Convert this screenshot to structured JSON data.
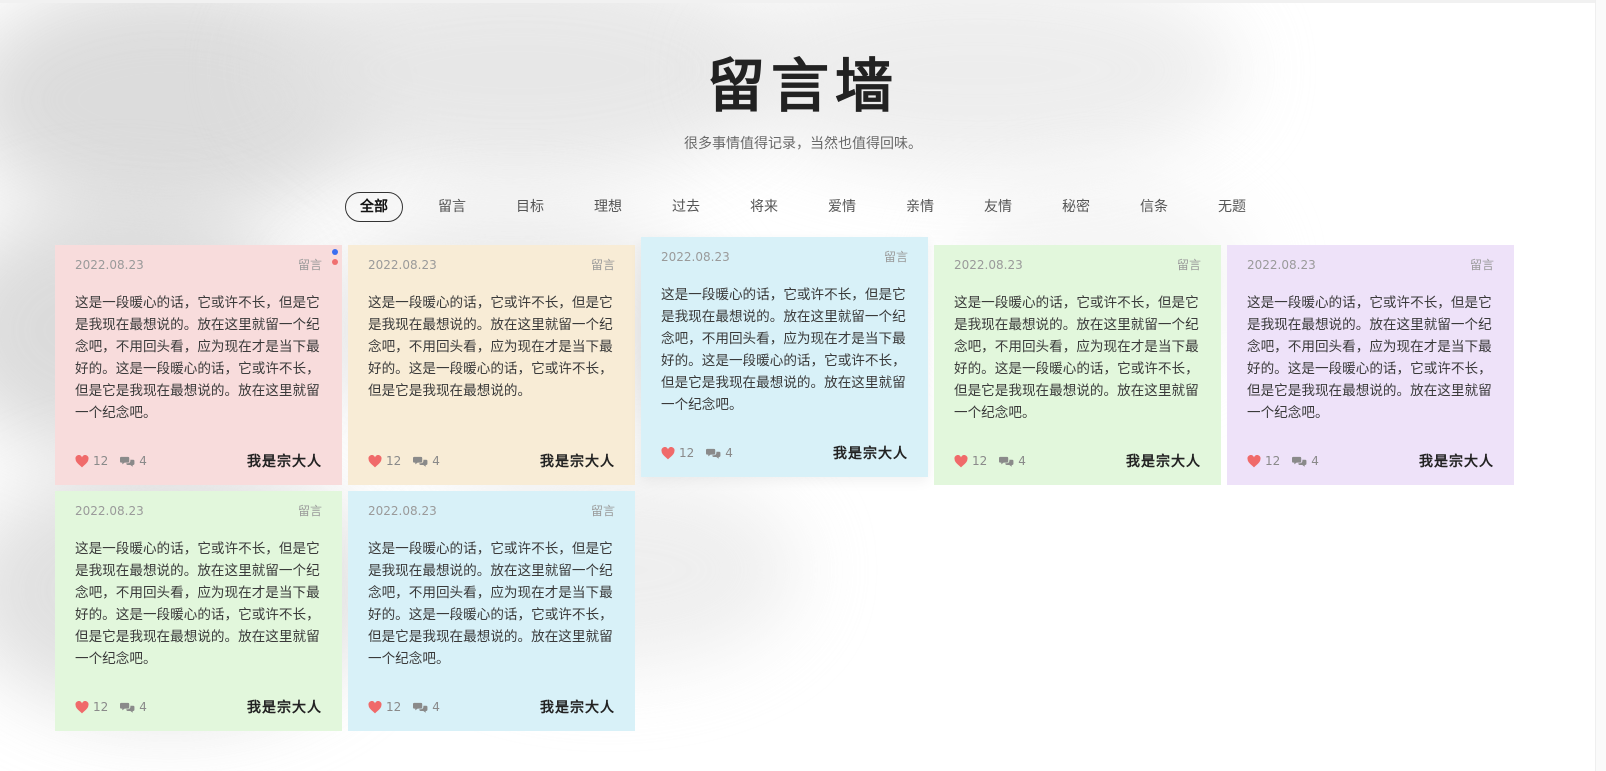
{
  "header": {
    "title": "留言墙",
    "subtitle": "很多事情值得记录，当然也值得回味。"
  },
  "tabs": [
    "全部",
    "留言",
    "目标",
    "理想",
    "过去",
    "将来",
    "爱情",
    "亲情",
    "友情",
    "秘密",
    "信条",
    "无题"
  ],
  "active_tab": "全部",
  "cards": [
    {
      "date": "2022.08.23",
      "category": "留言",
      "text": "这是一段暖心的话，它或许不长，但是它是我现在最想说的。放在这里就留一个纪念吧，不用回头看，应为现在才是当下最好的。这是一段暖心的话，它或许不长，但是它是我现在最想说的。放在这里就留一个纪念吧。",
      "likes": "12",
      "comments": "4",
      "author": "我是宗大人",
      "color": "#f8dcdc"
    },
    {
      "date": "2022.08.23",
      "category": "留言",
      "text": "这是一段暖心的话，它或许不长，但是它是我现在最想说的。放在这里就留一个纪念吧，不用回头看，应为现在才是当下最好的。这是一段暖心的话，它或许不长，但是它是我现在最想说的。",
      "likes": "12",
      "comments": "4",
      "author": "我是宗大人",
      "color": "#f8ecd6"
    },
    {
      "date": "2022.08.23",
      "category": "留言",
      "text": "这是一段暖心的话，它或许不长，但是它是我现在最想说的。放在这里就留一个纪念吧，不用回头看，应为现在才是当下最好的。这是一段暖心的话，它或许不长，但是它是我现在最想说的。放在这里就留一个纪念吧。",
      "likes": "12",
      "comments": "4",
      "author": "我是宗大人",
      "color": "#d8f1f8"
    },
    {
      "date": "2022.08.23",
      "category": "留言",
      "text": "这是一段暖心的话，它或许不长，但是它是我现在最想说的。放在这里就留一个纪念吧，不用回头看，应为现在才是当下最好的。这是一段暖心的话，它或许不长，但是它是我现在最想说的。放在这里就留一个纪念吧。",
      "likes": "12",
      "comments": "4",
      "author": "我是宗大人",
      "color": "#e2f7dc"
    },
    {
      "date": "2022.08.23",
      "category": "留言",
      "text": "这是一段暖心的话，它或许不长，但是它是我现在最想说的。放在这里就留一个纪念吧，不用回头看，应为现在才是当下最好的。这是一段暖心的话，它或许不长，但是它是我现在最想说的。放在这里就留一个纪念吧。",
      "likes": "12",
      "comments": "4",
      "author": "我是宗大人",
      "color": "#eee2f9"
    },
    {
      "date": "2022.08.23",
      "category": "留言",
      "text": "这是一段暖心的话，它或许不长，但是它是我现在最想说的。放在这里就留一个纪念吧，不用回头看，应为现在才是当下最好的。这是一段暖心的话，它或许不长，但是它是我现在最想说的。放在这里就留一个纪念吧。",
      "likes": "12",
      "comments": "4",
      "author": "我是宗大人",
      "color": "#e2f7dc"
    },
    {
      "date": "2022.08.23",
      "category": "留言",
      "text": "这是一段暖心的话，它或许不长，但是它是我现在最想说的。放在这里就留一个纪念吧，不用回头看，应为现在才是当下最好的。这是一段暖心的话，它或许不长，但是它是我现在最想说的。放在这里就留一个纪念吧。",
      "likes": "12",
      "comments": "4",
      "author": "我是宗大人",
      "color": "#d8f1f8"
    }
  ],
  "accent": {
    "heart": "#f06a6a",
    "comment": "#8a8a8a",
    "dot_blue": "#3b6ef0",
    "dot_red": "#f07070"
  },
  "icons": {
    "like": "heart-icon",
    "comment": "comment-bubbles-icon"
  }
}
